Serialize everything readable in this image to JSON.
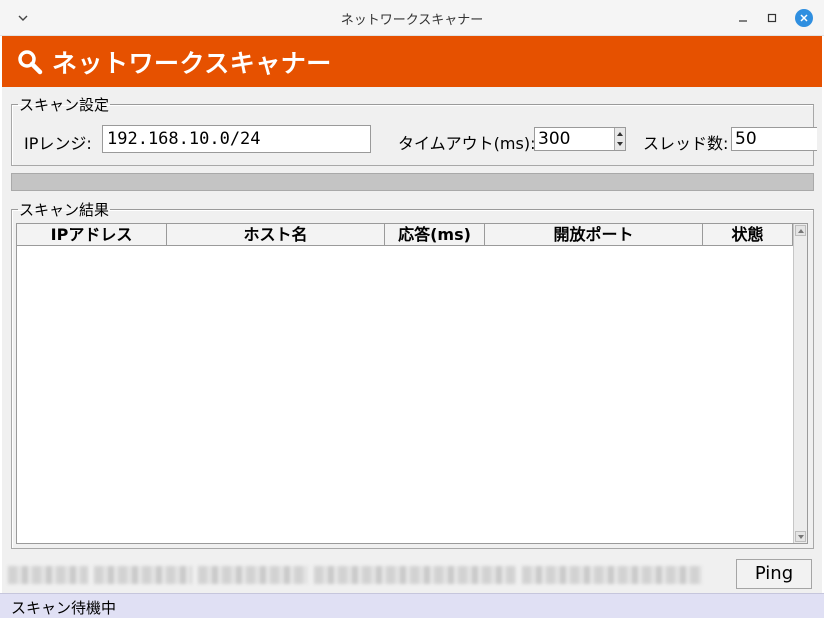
{
  "window": {
    "title": "ネットワークスキャナー",
    "menu_icon": "chevron-down-icon",
    "min_icon": "minimize-icon",
    "max_icon": "maximize-icon",
    "close_icon": "close-icon"
  },
  "banner": {
    "icon": "search-icon",
    "title": "ネットワークスキャナー",
    "color": "#e65100"
  },
  "settings": {
    "legend": "スキャン設定",
    "ip_label": "IPレンジ:",
    "ip_value": "192.168.10.0/24",
    "timeout_label": "タイムアウト(ms):",
    "timeout_value": "300",
    "threads_label": "スレッド数:",
    "threads_value": "50"
  },
  "progress": {
    "value": 0
  },
  "results": {
    "legend": "スキャン結果",
    "columns": [
      "IPアドレス",
      "ホスト名",
      "応答(ms)",
      "開放ポート",
      "状態"
    ],
    "rows": []
  },
  "footer": {
    "ping_label": "Ping"
  },
  "status": {
    "text": "スキャン待機中"
  }
}
